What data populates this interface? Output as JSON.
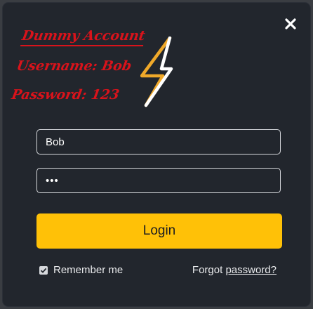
{
  "demo_note": {
    "title": "Dummy Account",
    "username_line": "Username: Bob",
    "password_line": "Password: 123"
  },
  "form": {
    "username_value": "Bob",
    "password_value": "123",
    "login_label": "Login",
    "remember_label": "Remember me",
    "remember_checked": true,
    "forgot_prefix": "Forgot",
    "forgot_link": "password?"
  },
  "colors": {
    "modal_bg": "#22262d",
    "accent": "#ffc107",
    "note_red": "#d9131b"
  },
  "icons": {
    "close": "close-icon",
    "logo": "lightning-bolt-logo-icon",
    "checkbox": "checkmark-icon"
  }
}
